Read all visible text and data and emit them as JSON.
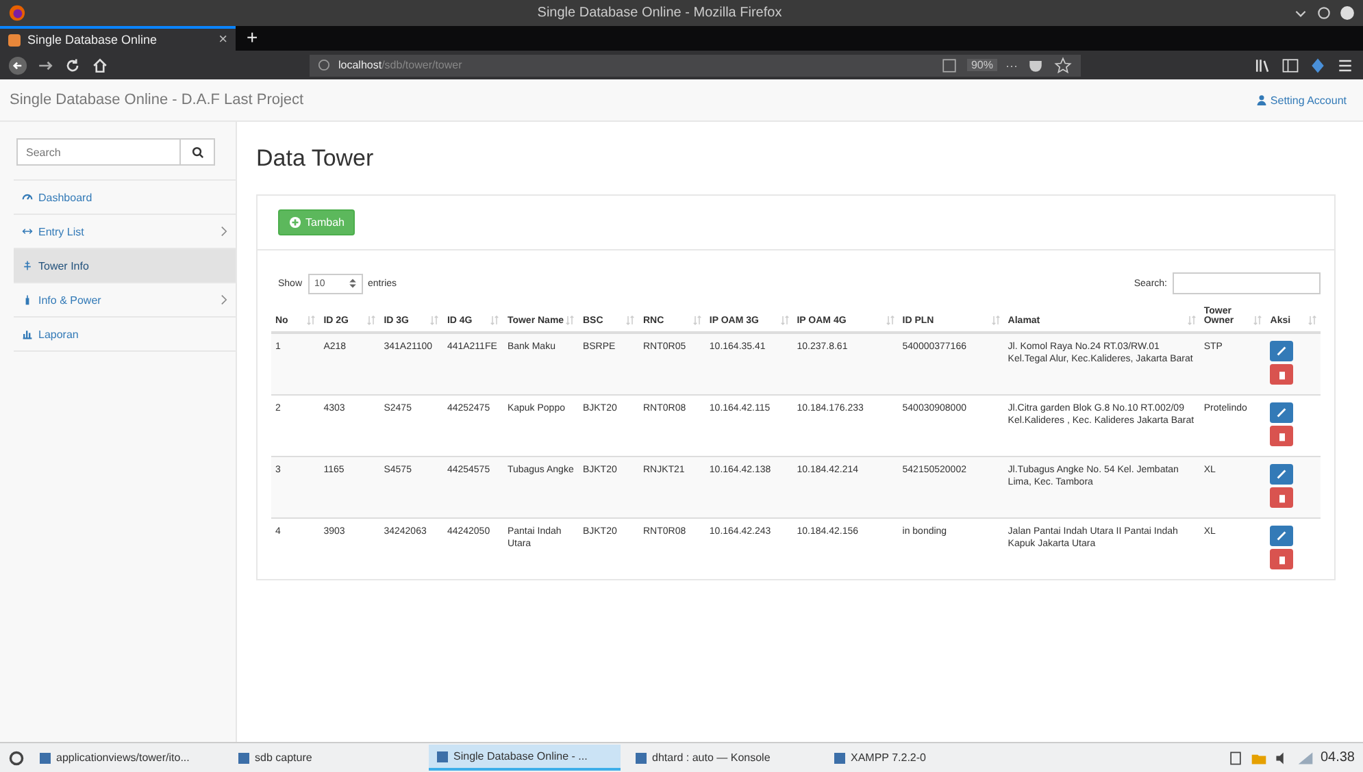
{
  "window": {
    "title": "Single Database Online - Mozilla Firefox"
  },
  "browser_tab": {
    "label": "Single Database Online",
    "close": "×",
    "new_tab": "+"
  },
  "address_bar": {
    "host": "localhost",
    "path": "/sdb/tower/tower",
    "zoom": "90%",
    "more": "···"
  },
  "page_header": {
    "brand": "Single Database Online - D.A.F Last Project",
    "account_link": "Setting Account"
  },
  "sidebar": {
    "search": {
      "placeholder": "Search"
    },
    "items": [
      {
        "label": "Dashboard",
        "selected": false,
        "has_submenu": false
      },
      {
        "label": "Entry List",
        "selected": false,
        "has_submenu": true
      },
      {
        "label": "Tower Info",
        "selected": true,
        "has_submenu": false
      },
      {
        "label": "Info & Power",
        "selected": false,
        "has_submenu": true
      },
      {
        "label": "Laporan",
        "selected": false,
        "has_submenu": false
      }
    ]
  },
  "content": {
    "title": "Data Tower",
    "add_button": "Tambah",
    "show_label": "Show",
    "page_size": "10",
    "entries_label": "entries",
    "search_label": "Search:",
    "table": {
      "columns": [
        "No",
        "ID 2G",
        "ID 3G",
        "ID 4G",
        "Tower Name",
        "BSC",
        "RNC",
        "IP OAM 3G",
        "IP OAM 4G",
        "ID PLN",
        "Alamat",
        "Tower Owner",
        "Aksi"
      ],
      "rows": [
        {
          "cells": [
            "1",
            "A218",
            "341A21100",
            "441A211FE",
            "Bank Maku",
            "BSRPE",
            "RNT0R05",
            "10.164.35.41",
            "10.237.8.61",
            "540000377166",
            "Jl. Komol Raya No.24 RT.03/RW.01 Kel.Tegal Alur, Kec.Kalideres, Jakarta Barat",
            "STP"
          ]
        },
        {
          "cells": [
            "2",
            "4303",
            "S2475",
            "44252475",
            "Kapuk Poppo",
            "BJKT20",
            "RNT0R08",
            "10.164.42.115",
            "10.184.176.233",
            "540030908000",
            "Jl.Citra garden Blok G.8 No.10 RT.002/09 Kel.Kalideres , Kec. Kalideres Jakarta Barat",
            "Protelindo"
          ]
        },
        {
          "cells": [
            "3",
            "1165",
            "S4575",
            "44254575",
            "Tubagus Angke",
            "BJKT20",
            "RNJKT21",
            "10.164.42.138",
            "10.184.42.214",
            "542150520002",
            "Jl.Tubagus Angke No. 54 Kel. Jembatan Lima, Kec. Tambora",
            "XL"
          ]
        },
        {
          "cells": [
            "4",
            "3903",
            "34242063",
            "44242050",
            "Pantai Indah Utara",
            "BJKT20",
            "RNT0R08",
            "10.164.42.243",
            "10.184.42.156",
            "in bonding",
            "Jalan Pantai Indah Utara II Pantai Indah Kapuk Jakarta Utara",
            "XL"
          ]
        }
      ]
    }
  },
  "taskbar": {
    "items": [
      {
        "label": "applicationviews/tower/ito...",
        "selected": false
      },
      {
        "label": "sdb capture",
        "selected": false
      },
      {
        "label": "Single Database Online - ...",
        "selected": true
      },
      {
        "label": "dhtard : auto — Konsole",
        "selected": false
      },
      {
        "label": "XAMPP 7.2.2-0",
        "selected": false
      }
    ],
    "clock": "04.38"
  }
}
